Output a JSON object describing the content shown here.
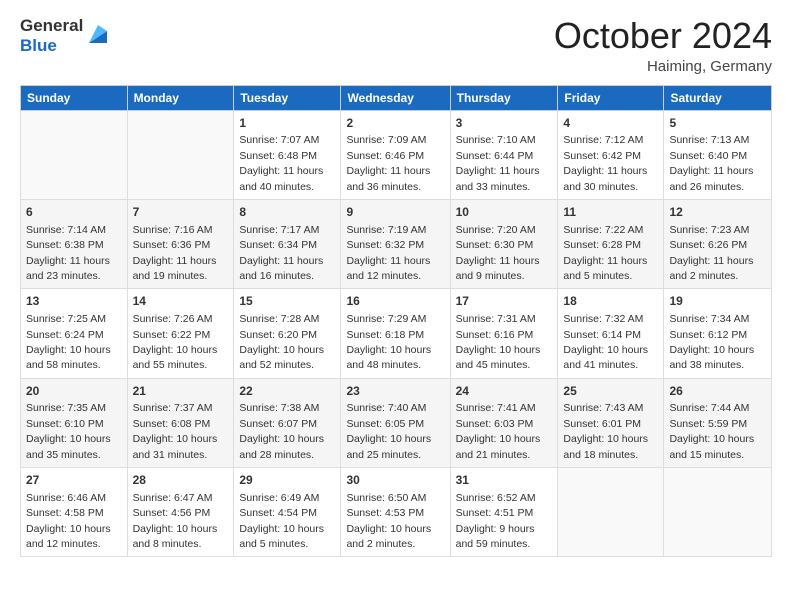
{
  "logo": {
    "general": "General",
    "blue": "Blue"
  },
  "title": {
    "month": "October 2024",
    "location": "Haiming, Germany"
  },
  "weekdays": [
    "Sunday",
    "Monday",
    "Tuesday",
    "Wednesday",
    "Thursday",
    "Friday",
    "Saturday"
  ],
  "weeks": [
    [
      {
        "day": "",
        "info": ""
      },
      {
        "day": "",
        "info": ""
      },
      {
        "day": "1",
        "info": "Sunrise: 7:07 AM\nSunset: 6:48 PM\nDaylight: 11 hours and 40 minutes."
      },
      {
        "day": "2",
        "info": "Sunrise: 7:09 AM\nSunset: 6:46 PM\nDaylight: 11 hours and 36 minutes."
      },
      {
        "day": "3",
        "info": "Sunrise: 7:10 AM\nSunset: 6:44 PM\nDaylight: 11 hours and 33 minutes."
      },
      {
        "day": "4",
        "info": "Sunrise: 7:12 AM\nSunset: 6:42 PM\nDaylight: 11 hours and 30 minutes."
      },
      {
        "day": "5",
        "info": "Sunrise: 7:13 AM\nSunset: 6:40 PM\nDaylight: 11 hours and 26 minutes."
      }
    ],
    [
      {
        "day": "6",
        "info": "Sunrise: 7:14 AM\nSunset: 6:38 PM\nDaylight: 11 hours and 23 minutes."
      },
      {
        "day": "7",
        "info": "Sunrise: 7:16 AM\nSunset: 6:36 PM\nDaylight: 11 hours and 19 minutes."
      },
      {
        "day": "8",
        "info": "Sunrise: 7:17 AM\nSunset: 6:34 PM\nDaylight: 11 hours and 16 minutes."
      },
      {
        "day": "9",
        "info": "Sunrise: 7:19 AM\nSunset: 6:32 PM\nDaylight: 11 hours and 12 minutes."
      },
      {
        "day": "10",
        "info": "Sunrise: 7:20 AM\nSunset: 6:30 PM\nDaylight: 11 hours and 9 minutes."
      },
      {
        "day": "11",
        "info": "Sunrise: 7:22 AM\nSunset: 6:28 PM\nDaylight: 11 hours and 5 minutes."
      },
      {
        "day": "12",
        "info": "Sunrise: 7:23 AM\nSunset: 6:26 PM\nDaylight: 11 hours and 2 minutes."
      }
    ],
    [
      {
        "day": "13",
        "info": "Sunrise: 7:25 AM\nSunset: 6:24 PM\nDaylight: 10 hours and 58 minutes."
      },
      {
        "day": "14",
        "info": "Sunrise: 7:26 AM\nSunset: 6:22 PM\nDaylight: 10 hours and 55 minutes."
      },
      {
        "day": "15",
        "info": "Sunrise: 7:28 AM\nSunset: 6:20 PM\nDaylight: 10 hours and 52 minutes."
      },
      {
        "day": "16",
        "info": "Sunrise: 7:29 AM\nSunset: 6:18 PM\nDaylight: 10 hours and 48 minutes."
      },
      {
        "day": "17",
        "info": "Sunrise: 7:31 AM\nSunset: 6:16 PM\nDaylight: 10 hours and 45 minutes."
      },
      {
        "day": "18",
        "info": "Sunrise: 7:32 AM\nSunset: 6:14 PM\nDaylight: 10 hours and 41 minutes."
      },
      {
        "day": "19",
        "info": "Sunrise: 7:34 AM\nSunset: 6:12 PM\nDaylight: 10 hours and 38 minutes."
      }
    ],
    [
      {
        "day": "20",
        "info": "Sunrise: 7:35 AM\nSunset: 6:10 PM\nDaylight: 10 hours and 35 minutes."
      },
      {
        "day": "21",
        "info": "Sunrise: 7:37 AM\nSunset: 6:08 PM\nDaylight: 10 hours and 31 minutes."
      },
      {
        "day": "22",
        "info": "Sunrise: 7:38 AM\nSunset: 6:07 PM\nDaylight: 10 hours and 28 minutes."
      },
      {
        "day": "23",
        "info": "Sunrise: 7:40 AM\nSunset: 6:05 PM\nDaylight: 10 hours and 25 minutes."
      },
      {
        "day": "24",
        "info": "Sunrise: 7:41 AM\nSunset: 6:03 PM\nDaylight: 10 hours and 21 minutes."
      },
      {
        "day": "25",
        "info": "Sunrise: 7:43 AM\nSunset: 6:01 PM\nDaylight: 10 hours and 18 minutes."
      },
      {
        "day": "26",
        "info": "Sunrise: 7:44 AM\nSunset: 5:59 PM\nDaylight: 10 hours and 15 minutes."
      }
    ],
    [
      {
        "day": "27",
        "info": "Sunrise: 6:46 AM\nSunset: 4:58 PM\nDaylight: 10 hours and 12 minutes."
      },
      {
        "day": "28",
        "info": "Sunrise: 6:47 AM\nSunset: 4:56 PM\nDaylight: 10 hours and 8 minutes."
      },
      {
        "day": "29",
        "info": "Sunrise: 6:49 AM\nSunset: 4:54 PM\nDaylight: 10 hours and 5 minutes."
      },
      {
        "day": "30",
        "info": "Sunrise: 6:50 AM\nSunset: 4:53 PM\nDaylight: 10 hours and 2 minutes."
      },
      {
        "day": "31",
        "info": "Sunrise: 6:52 AM\nSunset: 4:51 PM\nDaylight: 9 hours and 59 minutes."
      },
      {
        "day": "",
        "info": ""
      },
      {
        "day": "",
        "info": ""
      }
    ]
  ]
}
